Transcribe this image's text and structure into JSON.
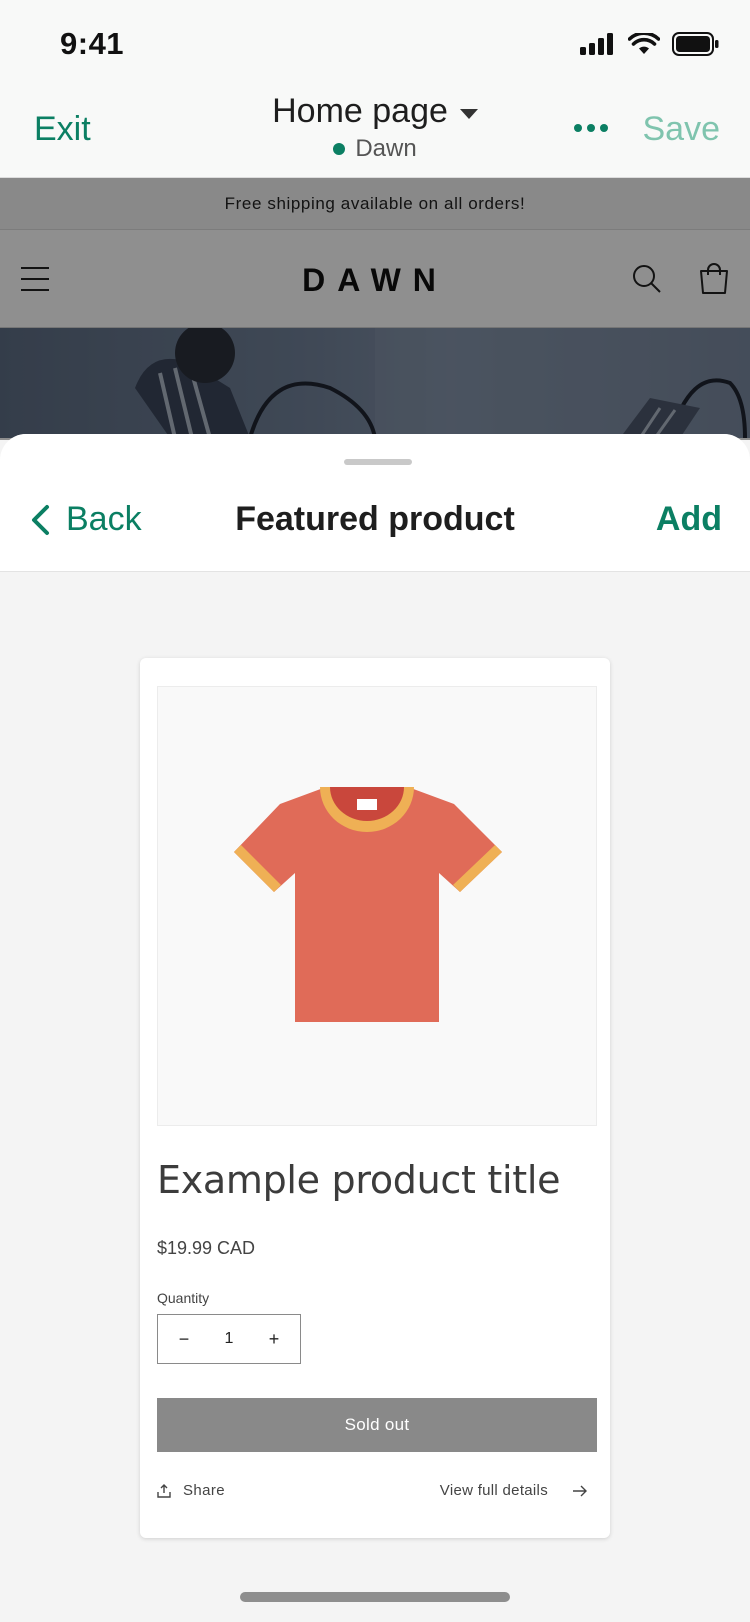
{
  "status_bar": {
    "time": "9:41"
  },
  "editor_header": {
    "exit_label": "Exit",
    "page_title": "Home page",
    "theme_name": "Dawn",
    "save_label": "Save"
  },
  "preview": {
    "announcement": "Free shipping available on all orders!",
    "store_logo": "DAWN"
  },
  "sheet": {
    "back_label": "Back",
    "title": "Featured product",
    "add_label": "Add"
  },
  "product": {
    "title": "Example product title",
    "price": "$19.99 CAD",
    "quantity_label": "Quantity",
    "quantity_value": "1",
    "sold_out_label": "Sold out",
    "share_label": "Share",
    "view_details_label": "View full details"
  },
  "colors": {
    "accent": "#0b7f63",
    "save_disabled": "#7fc4ae",
    "tshirt_body": "#e06b58",
    "tshirt_trim": "#efb055"
  }
}
